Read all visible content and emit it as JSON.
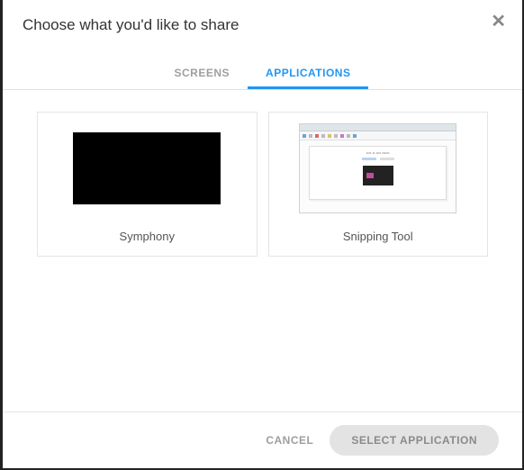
{
  "dialog": {
    "title": "Choose what you'd like to share"
  },
  "tabs": {
    "screens": "SCREENS",
    "applications": "APPLICATIONS",
    "active": "applications"
  },
  "apps": [
    {
      "label": "Symphony"
    },
    {
      "label": "Snipping Tool"
    }
  ],
  "footer": {
    "cancel": "CANCEL",
    "select": "SELECT APPLICATION"
  }
}
